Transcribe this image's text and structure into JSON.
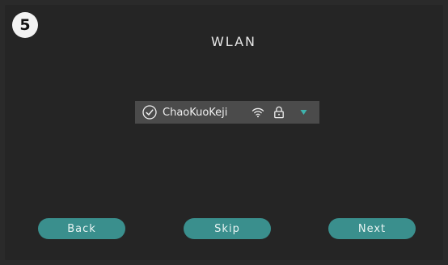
{
  "step": {
    "number": "5"
  },
  "page": {
    "title": "WLAN"
  },
  "network": {
    "name": "ChaoKuoKeji",
    "connected_icon": "check-circle-icon",
    "signal_icon": "wifi-icon",
    "security_icon": "lock-icon",
    "dropdown_icon": "caret-down-icon"
  },
  "buttons": {
    "back": "Back",
    "skip": "Skip",
    "next": "Next"
  },
  "colors": {
    "background": "#252525",
    "selector_bg": "#4b4b4b",
    "accent": "#3a8f8d",
    "dropdown_caret": "#3fb3ad"
  }
}
